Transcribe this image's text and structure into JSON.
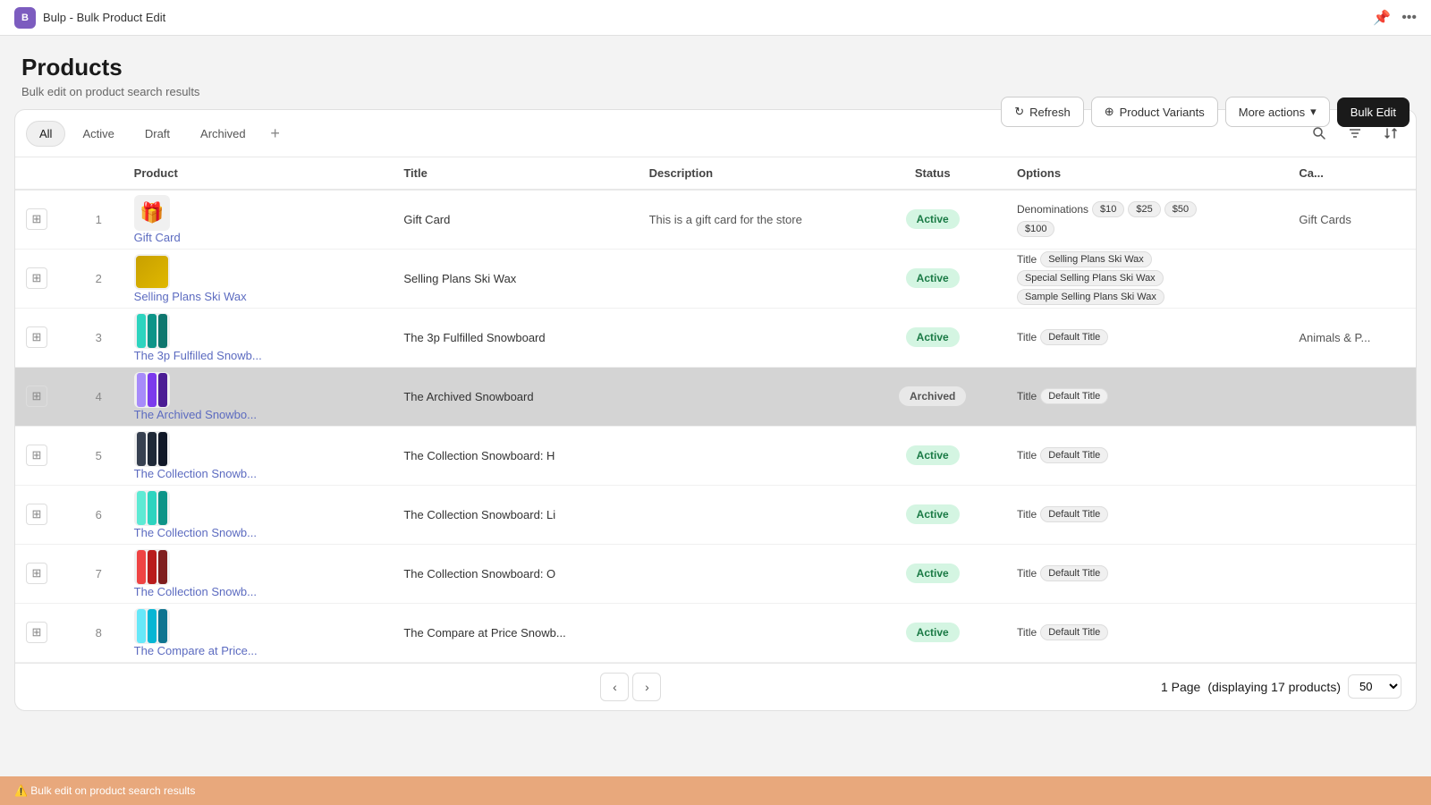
{
  "app": {
    "icon_text": "B",
    "title": "Bulp - Bulk Product Edit"
  },
  "header": {
    "title": "Products",
    "subtitle": "Bulk edit on product search results",
    "btn_refresh": "Refresh",
    "btn_variants": "Product Variants",
    "btn_more": "More actions",
    "btn_bulk_edit": "Bulk Edit"
  },
  "tabs": [
    {
      "label": "All",
      "active": true
    },
    {
      "label": "Active",
      "active": false
    },
    {
      "label": "Draft",
      "active": false
    },
    {
      "label": "Archived",
      "active": false
    }
  ],
  "columns": [
    {
      "label": ""
    },
    {
      "label": ""
    },
    {
      "label": "Product"
    },
    {
      "label": "Title"
    },
    {
      "label": "Description"
    },
    {
      "label": "Status"
    },
    {
      "label": "Options"
    },
    {
      "label": "Ca..."
    }
  ],
  "rows": [
    {
      "num": "1",
      "name": "Gift Card",
      "link_text": "Gift Card",
      "title": "Gift Card",
      "description": "This is a gift card for the store",
      "status": "Active",
      "status_type": "active",
      "options": [
        {
          "label": "Denominations",
          "tags": [
            "$10",
            "$25",
            "$50",
            "$100"
          ]
        }
      ],
      "category": "Gift Cards",
      "archived": false,
      "img_type": "gift"
    },
    {
      "num": "2",
      "name": "Selling Plans Ski Wax",
      "link_text": "Selling Plans Ski Wax",
      "title": "Selling Plans Ski Wax",
      "description": "",
      "status": "Active",
      "status_type": "active",
      "options": [
        {
          "label": "Title",
          "tags": [
            "Selling Plans Ski Wax"
          ]
        },
        {
          "label": "",
          "tags": [
            "Special Selling Plans Ski Wax"
          ]
        },
        {
          "label": "",
          "tags": [
            "Sample Selling Plans Ski Wax"
          ]
        }
      ],
      "category": "",
      "archived": false,
      "img_type": "ski"
    },
    {
      "num": "3",
      "name": "The 3p Fulfilled Snowboard",
      "link_text": "The 3p Fulfilled Snowb...",
      "title": "The 3p Fulfilled Snowboard",
      "description": "",
      "status": "Active",
      "status_type": "active",
      "options": [
        {
          "label": "Title",
          "tags": [
            "Default Title"
          ]
        }
      ],
      "category": "Animals & P...",
      "archived": false,
      "img_type": "snowboard_teal"
    },
    {
      "num": "4",
      "name": "The Archived Snowboard",
      "link_text": "The Archived Snowbo...",
      "title": "The Archived Snowboard",
      "description": "",
      "status": "Archived",
      "status_type": "archived",
      "options": [
        {
          "label": "Title",
          "tags": [
            "Default Title"
          ]
        }
      ],
      "category": "",
      "archived": true,
      "img_type": "snowboard_purple"
    },
    {
      "num": "5",
      "name": "The Collection Snowboard: H",
      "link_text": "The Collection Snowb...",
      "title": "The Collection Snowboard: H",
      "description": "",
      "status": "Active",
      "status_type": "active",
      "options": [
        {
          "label": "Title",
          "tags": [
            "Default Title"
          ]
        }
      ],
      "category": "",
      "archived": false,
      "img_type": "snowboard_dark"
    },
    {
      "num": "6",
      "name": "The Collection Snowboard: Li",
      "link_text": "The Collection Snowb...",
      "title": "The Collection Snowboard: Li",
      "description": "",
      "status": "Active",
      "status_type": "active",
      "options": [
        {
          "label": "Title",
          "tags": [
            "Default Title"
          ]
        }
      ],
      "category": "",
      "archived": false,
      "img_type": "snowboard_teal2"
    },
    {
      "num": "7",
      "name": "The Collection Snowboard: O",
      "link_text": "The Collection Snowb...",
      "title": "The Collection Snowboard: O",
      "description": "",
      "status": "Active",
      "status_type": "active",
      "options": [
        {
          "label": "Title",
          "tags": [
            "Default Title"
          ]
        }
      ],
      "category": "",
      "archived": false,
      "img_type": "snowboard_red"
    },
    {
      "num": "8",
      "name": "The Compare at Price Snowboard",
      "link_text": "The Compare at Price...",
      "title": "The Compare at Price Snowb...",
      "description": "",
      "status": "Active",
      "status_type": "active",
      "options": [
        {
          "label": "Title",
          "tags": [
            "Default Title"
          ]
        }
      ],
      "category": "",
      "archived": false,
      "img_type": "snowboard_cyan"
    }
  ],
  "pagination": {
    "page_label": "1 Page",
    "total_label": "(displaying 17 products)",
    "per_page_value": "50"
  }
}
